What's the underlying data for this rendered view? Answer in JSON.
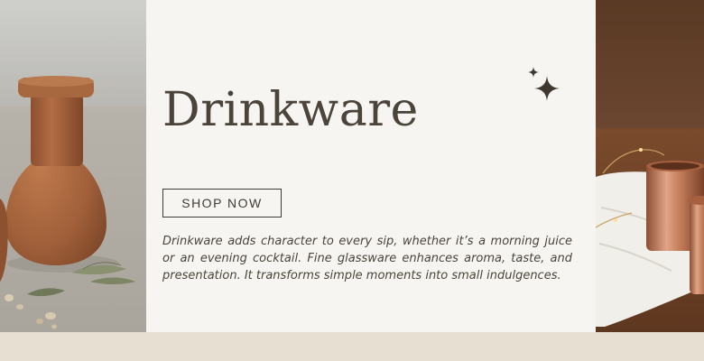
{
  "banner": {
    "headline": "Drinkware",
    "cta_label": "SHOP NOW",
    "description": "Drinkware adds character to every sip, whether it’s a morning juice or an evening cocktail. Fine glassware enhances aroma, taste, and presentation. It transforms simple moments into small indulgences.",
    "sparkle_icon": "sparkle-icon"
  },
  "colors": {
    "panel_background": "#f7f5f2",
    "text": "#4a443a",
    "footer_strip": "#e6dfd2",
    "terracotta": "#a6633a",
    "copper": "#c98a66"
  }
}
